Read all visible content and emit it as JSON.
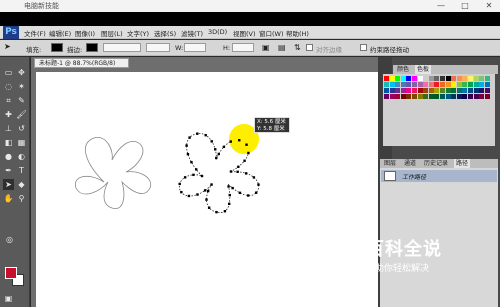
{
  "window": {
    "title": "电脑新技能",
    "controls": [
      "—",
      "□",
      "✕"
    ]
  },
  "app": {
    "logo": "Ps"
  },
  "menu": [
    "文件(F)",
    "编辑(E)",
    "图像(I)",
    "图层(L)",
    "文字(Y)",
    "选择(S)",
    "滤镜(T)",
    "3D(D)",
    "视图(V)",
    "窗口(W)",
    "帮助(H)"
  ],
  "options": {
    "fill_label": "填充:",
    "stroke_label": "描边:",
    "w_label": "W:",
    "h_label": "H:",
    "align_edges_label": "对齐边缘",
    "constrain_label": "约束路径拖动"
  },
  "document": {
    "tab_label": "未标题-1 @ 88.7%(RGB/8)"
  },
  "panels": {
    "top_tabs": [
      "颜色",
      "色板"
    ],
    "bottom_tabs": [
      "图层",
      "通道",
      "历史记录",
      "路径"
    ],
    "path_item": "工作路径",
    "swatch_colors": [
      "#ff0000",
      "#ffff00",
      "#00ff00",
      "#00ffff",
      "#0000ff",
      "#ff00ff",
      "#ffffff",
      "#cccccc",
      "#999999",
      "#666666",
      "#333333",
      "#000000",
      "#f26c4f",
      "#f68e55",
      "#fbaf5c",
      "#fff467",
      "#acd372",
      "#7cc576",
      "#3bb878",
      "#1abbb4",
      "#00bff3",
      "#438ccb",
      "#5574b9",
      "#605ca8",
      "#855fa8",
      "#a763a8",
      "#f06ea9",
      "#f26d7d",
      "#ed1c24",
      "#f26522",
      "#f7941d",
      "#fff200",
      "#8dc63f",
      "#39b54a",
      "#00a651",
      "#00a99d",
      "#00aeef",
      "#0072bc",
      "#0054a6",
      "#2e3192",
      "#662d91",
      "#92278f",
      "#ec008c",
      "#ed145b",
      "#9e0b0f",
      "#a0410d",
      "#a36209",
      "#aba000",
      "#598527",
      "#197b30",
      "#007236",
      "#00746b",
      "#0076a3",
      "#004b80",
      "#003471",
      "#1b1464",
      "#440e62",
      "#630460",
      "#9e005d",
      "#9e0039",
      "#790000",
      "#7b2e00",
      "#7d4900",
      "#827b00",
      "#406618",
      "#005e20",
      "#005826",
      "#005952",
      "#005b7f",
      "#003663",
      "#002157",
      "#0d004c",
      "#32004b",
      "#4b0049",
      "#7b0046",
      "#7a0026"
    ]
  },
  "tooltip": {
    "line1": "X: 5.6 厘米",
    "line2": "Y: 5.8 厘米"
  },
  "watermark": {
    "title": "百科全说",
    "subtitle": "助你轻松解决"
  },
  "colors": {
    "foreground": "#c8102e",
    "background": "#ffffff",
    "highlight": "#ffee00"
  }
}
